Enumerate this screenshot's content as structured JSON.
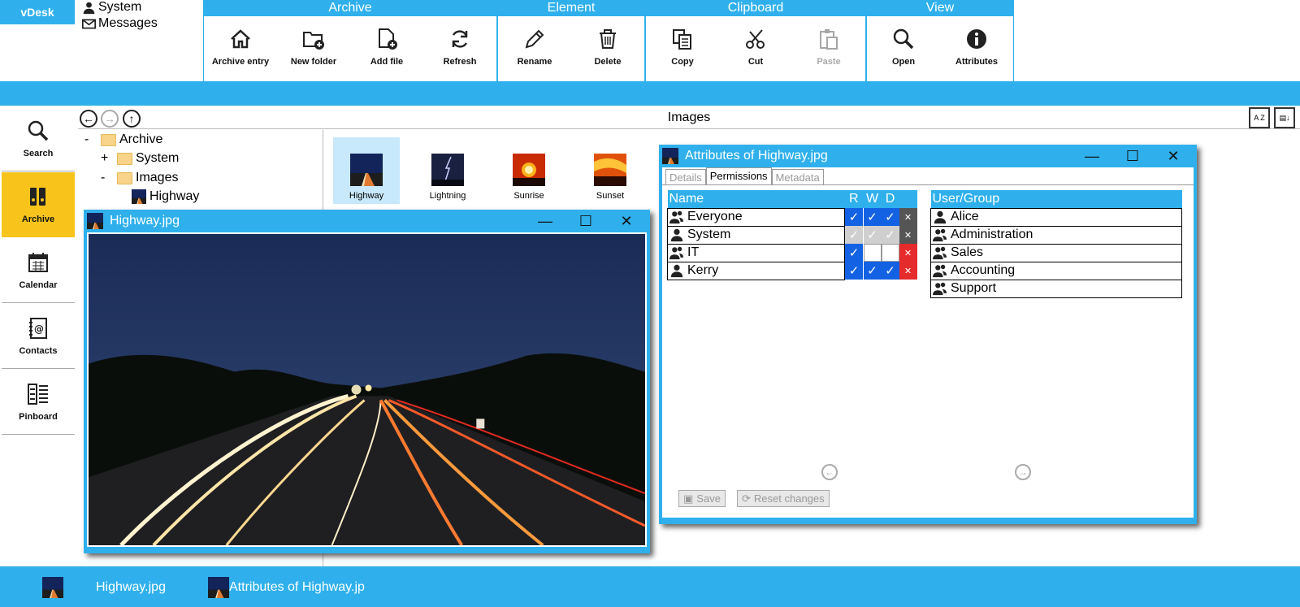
{
  "app": {
    "brand": "vDesk"
  },
  "topmenu": [
    {
      "label": "System",
      "icon": "user-icon"
    },
    {
      "label": "Messages",
      "icon": "envelope-icon"
    }
  ],
  "ribbon": {
    "archive": {
      "title": "Archive",
      "buttons": [
        "Archive entry",
        "New folder",
        "Add file",
        "Refresh"
      ]
    },
    "element": {
      "title": "Element",
      "buttons": [
        "Rename",
        "Delete"
      ]
    },
    "clipboard": {
      "title": "Clipboard",
      "buttons": [
        "Copy",
        "Cut",
        "Paste"
      ]
    },
    "view": {
      "title": "View",
      "buttons": [
        "Open",
        "Attributes"
      ]
    }
  },
  "nav": [
    "Search",
    "Archive",
    "Calendar",
    "Contacts",
    "Pinboard"
  ],
  "explorer": {
    "title": "Images",
    "sort_label": "A Z"
  },
  "tree": {
    "root": "Archive",
    "system": "System",
    "images": "Images",
    "highway": "Highway",
    "expanders": {
      "root": "-",
      "system": "+",
      "images": "-"
    }
  },
  "thumbnails": [
    "Highway",
    "Lightning",
    "Sunrise",
    "Sunset"
  ],
  "viewer": {
    "title": "Highway.jpg"
  },
  "attributes": {
    "title": "Attributes of Highway.jpg",
    "tabs": [
      "Details",
      "Permissions",
      "Metadata"
    ],
    "columns": {
      "name": "Name",
      "r": "R",
      "w": "W",
      "d": "D",
      "usergroup": "User/Group"
    },
    "rows": [
      {
        "name": "Everyone",
        "icon": "group-icon",
        "r": true,
        "w": true,
        "d": true,
        "state": "normal"
      },
      {
        "name": "System",
        "icon": "user-icon",
        "r": true,
        "w": true,
        "d": true,
        "state": "disabled"
      },
      {
        "name": "IT",
        "icon": "group-icon",
        "r": true,
        "w": false,
        "d": false,
        "state": "normal"
      },
      {
        "name": "Kerry",
        "icon": "user-icon",
        "r": true,
        "w": true,
        "d": true,
        "state": "normal"
      }
    ],
    "users": [
      {
        "name": "Alice",
        "icon": "user-icon"
      },
      {
        "name": "Administration",
        "icon": "group-icon"
      },
      {
        "name": "Sales",
        "icon": "group-icon"
      },
      {
        "name": "Accounting",
        "icon": "group-icon"
      },
      {
        "name": "Support",
        "icon": "group-icon"
      }
    ],
    "save": "Save",
    "reset": "Reset changes"
  },
  "window_controls": {
    "minimize": "—",
    "maximize": "☐",
    "close": "✕"
  },
  "taskbar": [
    "Highway.jpg",
    "Attributes of Highway.jp"
  ],
  "colors": {
    "accent": "#2fb0ec",
    "active_nav": "#f8c41c",
    "check_on": "#1462e4",
    "delete": "#e52b2b"
  }
}
